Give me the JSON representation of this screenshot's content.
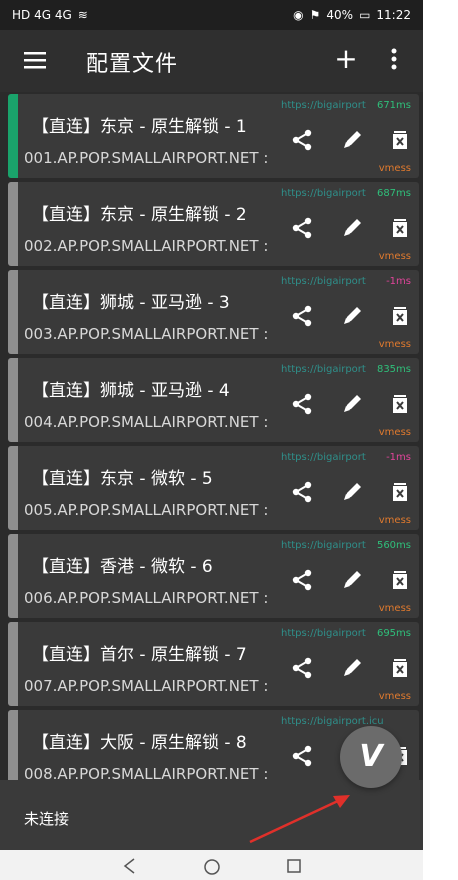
{
  "status_bar": {
    "left": "HD 4G 4G",
    "battery": "40%",
    "time": "11:22"
  },
  "appbar": {
    "title": "配置文件",
    "add_label": "+"
  },
  "profiles": [
    {
      "name": "【直连】东京 - 原生解锁 - 1",
      "address": "001.AP.POP.SMALLAIRPORT.NET :",
      "url": "https://bigairport",
      "latency": "671ms",
      "latency_color": "#2fbf7a",
      "type": "vmess",
      "active": true
    },
    {
      "name": "【直连】东京 - 原生解锁 - 2",
      "address": "002.AP.POP.SMALLAIRPORT.NET :",
      "url": "https://bigairport",
      "latency": "687ms",
      "latency_color": "#2fbf7a",
      "type": "vmess",
      "active": false
    },
    {
      "name": "【直连】狮城 - 亚马逊 - 3",
      "address": "003.AP.POP.SMALLAIRPORT.NET :",
      "url": "https://bigairport",
      "latency": "-1ms",
      "latency_color": "#e0449a",
      "type": "vmess",
      "active": false
    },
    {
      "name": "【直连】狮城 - 亚马逊 - 4",
      "address": "004.AP.POP.SMALLAIRPORT.NET :",
      "url": "https://bigairport",
      "latency": "835ms",
      "latency_color": "#2fbf7a",
      "type": "vmess",
      "active": false
    },
    {
      "name": "【直连】东京 - 微软 - 5",
      "address": "005.AP.POP.SMALLAIRPORT.NET :",
      "url": "https://bigairport",
      "latency": "-1ms",
      "latency_color": "#e0449a",
      "type": "vmess",
      "active": false
    },
    {
      "name": "【直连】香港 - 微软 - 6",
      "address": "006.AP.POP.SMALLAIRPORT.NET :",
      "url": "https://bigairport",
      "latency": "560ms",
      "latency_color": "#2fbf7a",
      "type": "vmess",
      "active": false
    },
    {
      "name": "【直连】首尔 - 原生解锁 - 7",
      "address": "007.AP.POP.SMALLAIRPORT.NET :",
      "url": "https://bigairport",
      "latency": "695ms",
      "latency_color": "#2fbf7a",
      "type": "vmess",
      "active": false
    },
    {
      "name": "【直连】大阪 - 原生解锁 - 8",
      "address": "008.AP.POP.SMALLAIRPORT.NET :",
      "url": "https://bigairport.icu",
      "latency": "",
      "latency_color": "#2fbf7a",
      "type": "",
      "active": false
    }
  ],
  "bottom": {
    "connection_status": "未连接",
    "fab_label": "V"
  },
  "icons": {
    "menu": "menu-icon",
    "add": "plus-icon",
    "more": "more-vert-icon",
    "share": "share-icon",
    "edit": "pencil-icon",
    "delete": "trash-icon"
  }
}
